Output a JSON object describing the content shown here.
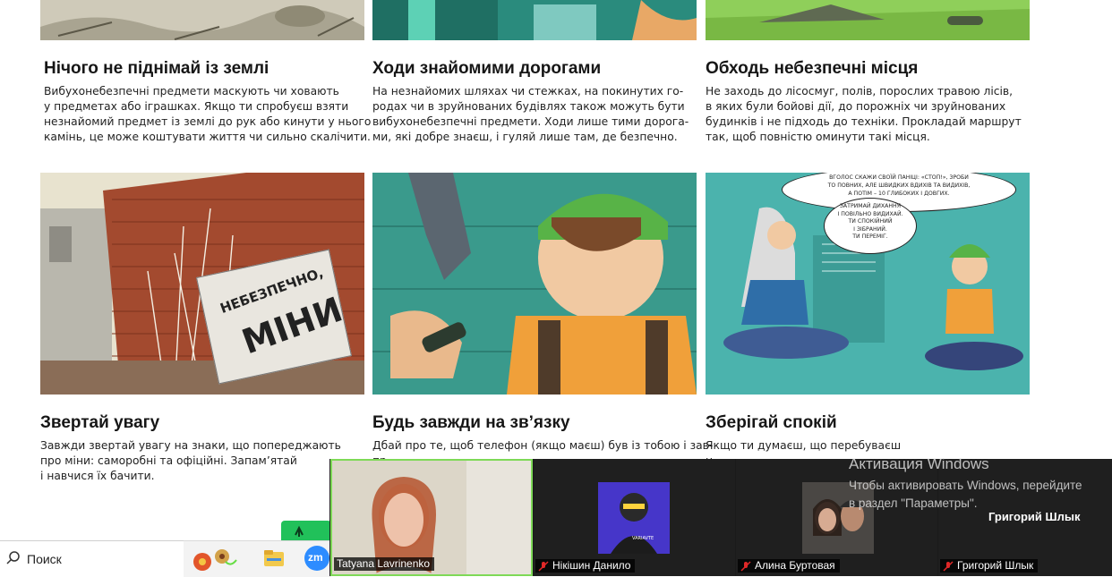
{
  "cards": [
    {
      "title": "Нічого не піднімай із землі",
      "lines": [
        "Вибухонебезпечні предмети маскують чи ховають",
        "у предметах або іграшках. Якщо ти спробуєш взяти",
        "незнайомий предмет із землі до рук або кинути у нього",
        "камінь, це може коштувати життя чи сильно скалічити."
      ]
    },
    {
      "title": "Ходи знайомими дорогами",
      "lines": [
        "На незнайомих шляхах чи стежках, на покинутих го-",
        "родах чи в зруйнованих будівлях також можуть бути",
        "вибухонебезпечні предмети. Ходи лише тими дорога-",
        "ми, які добре знаєш, і гуляй лише там, де безпечно."
      ]
    },
    {
      "title": "Обходь небезпечні місця",
      "lines": [
        "Не заходь до лісосмуг, полів, порослих травою лісів,",
        "в яких були бойові дії, до порожніх чи зруйнованих",
        "будинків і не підходь до техніки. Прокладай маршрут",
        "так, щоб повністю оминути такі місця."
      ]
    },
    {
      "title": "Звертай увагу",
      "lines": [
        "Завжди звертай увагу на знаки, що попереджають",
        "про міни: саморобні та офіційні. Запам’ятай",
        "і навчися їх бачити."
      ]
    },
    {
      "title": "Будь завжди на зв’язку",
      "lines": [
        "Дбай про те, щоб телефон (якщо маєш) був із тобою і зав-",
        "пр"
      ]
    },
    {
      "title": "Зберігай спокій",
      "lines": [
        "Якщо ти думаєш, що перебуваєш",
        "н"
      ]
    }
  ],
  "comic": {
    "sign_top": "НЕБЕЗПЕЧНО,",
    "sign_bottom": "МІНИ",
    "bubble1": [
      "ВГОЛОС СКАЖИ СВОЇЙ ПАНІЦІ: «СТОП!», ЗРОБИ",
      "ТО ПОВНИХ, АЛЕ ШВИДКИХ ВДИХІВ ТА ВИДИХІВ,",
      "А ПОТІМ – 10 ГЛИБОКИХ І ДОВГИХ."
    ],
    "bubble2": [
      "ЗАТРИМАЙ ДИХАННЯ",
      "І ПОВІЛЬНО ВИДИХАЙ.",
      "ТИ СПОКІЙНИЙ",
      "І ЗІБРАНИЙ.",
      "ТИ ПЕРЕМІГ."
    ]
  },
  "taskbar": {
    "search_label": "Поиск",
    "zoom_label": "zm"
  },
  "zoom": {
    "participants": [
      {
        "name": "Tatyana Lavrinenko",
        "muted": false
      },
      {
        "name": "Нікішин Данило",
        "muted": true
      },
      {
        "name": "Алина Буртовая",
        "muted": true
      },
      {
        "name": "Григорий Шлык",
        "muted": true
      }
    ],
    "speaker_name": "Григорий Шлык",
    "avatar_label": "VARIAVTE"
  },
  "activation": {
    "title": "Активация Windows",
    "line1": "Чтобы активировать Windows, перейдите",
    "line2": "в раздел \"Параметры\"."
  }
}
